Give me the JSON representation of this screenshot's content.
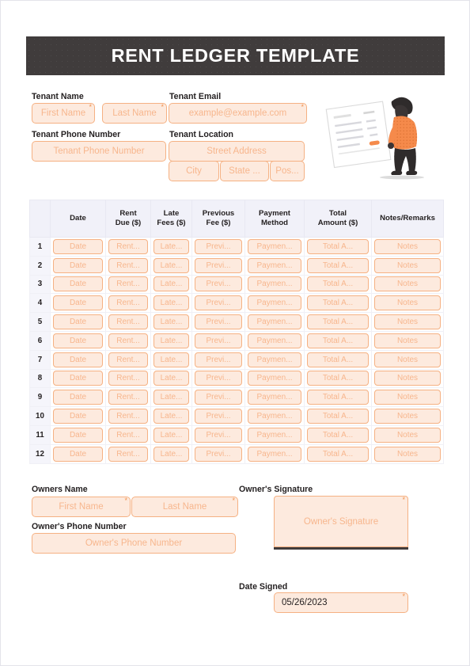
{
  "document": {
    "title": "RENT LEDGER TEMPLATE"
  },
  "tenant_section": {
    "name_label": "Tenant Name",
    "email_label": "Tenant Email",
    "phone_label": "Tenant Phone Number",
    "location_label": "Tenant Location",
    "fields": {
      "first_name_placeholder": "First Name",
      "last_name_placeholder": "Last Name",
      "email_placeholder": "example@example.com",
      "phone_placeholder": "Tenant Phone Number",
      "street_placeholder": "Street Address",
      "city_placeholder": "City",
      "state_placeholder": "State ...",
      "zip_placeholder": "Pos..."
    }
  },
  "ledger": {
    "columns": [
      "",
      "Date",
      "Rent\nDue ($)",
      "Late\nFees ($)",
      "Previous\nFee ($)",
      "Payment\nMethod",
      "Total\nAmount ($)",
      "Notes/Remarks"
    ],
    "column_lines": [
      [
        "Date"
      ],
      [
        "Rent",
        "Due ($)"
      ],
      [
        "Late",
        "Fees ($)"
      ],
      [
        "Previous",
        "Fee ($)"
      ],
      [
        "Payment",
        "Method"
      ],
      [
        "Total",
        "Amount ($)"
      ],
      [
        "Notes/Remarks"
      ]
    ],
    "row_numbers": [
      "1",
      "2",
      "3",
      "4",
      "5",
      "6",
      "7",
      "8",
      "9",
      "10",
      "11",
      "12"
    ],
    "cell_placeholders": {
      "date": "Date",
      "rent_due": "Rent...",
      "late_fees": "Late...",
      "previous_fee": "Previ...",
      "payment_method": "Paymen...",
      "total_amount": "Total A...",
      "notes": "Notes"
    },
    "row_count": 12
  },
  "owner_section": {
    "name_label": "Owners Name",
    "phone_label": "Owner's Phone Number",
    "signature_label": "Owner's Signature",
    "date_signed_label": "Date Signed",
    "fields": {
      "first_name_placeholder": "First Name",
      "last_name_placeholder": "Last Name",
      "phone_placeholder": "Owner's Phone Number",
      "signature_placeholder": "Owner's Signature",
      "date_signed_value": "05/26/2023"
    }
  },
  "illustration": {
    "name": "person-reviewing-document-illustration",
    "shirt_color": "#f58a4b",
    "document_color": "#ffffff",
    "accent_color": "#f58a4b"
  },
  "colors": {
    "header_bar": "#403c3c",
    "field_fill": "#fdeade",
    "field_border": "#f5b183",
    "placeholder_text": "#f7b68d",
    "required_asterisk": "#f0924e",
    "table_header_bg": "#f1f1f9",
    "rownum_bg": "#f5f5fb",
    "label_text": "#231f20"
  }
}
